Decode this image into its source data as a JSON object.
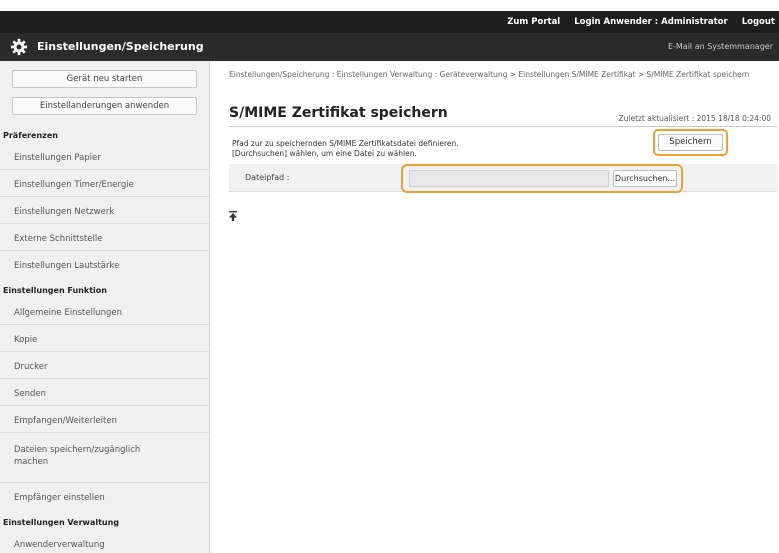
{
  "topbar": {
    "portal": "Zum Portal",
    "login_user": "Login Anwender : Administrator",
    "logout": "Logout"
  },
  "titlebar": {
    "icon": "gear-icon",
    "title": "Einstellungen/Speicherung",
    "mail": "E-Mail an Systemmanager"
  },
  "sidebar": {
    "buttons": [
      "Gerät neu starten",
      "Einstellanderungen anwenden"
    ],
    "sections": [
      {
        "label": "Präferenzen",
        "items": [
          "Einstellungen Papier",
          "Einstellungen Timer/Energie",
          "Einstellungen Netzwerk",
          "Externe Schnittstelle",
          "Einstellungen Lautstärke"
        ]
      },
      {
        "label": "Einstellungen Funktion",
        "items": [
          "Allgemeine Einstellungen",
          "Kopie",
          "Drucker",
          "Senden",
          "Empfangen/Weiterleiten",
          "Dateien speichern/zugänglich machen",
          "Empfänger einstellen"
        ]
      },
      {
        "label": "Einstellungen Verwaltung",
        "items": [
          "Anwenderverwaltung"
        ]
      }
    ]
  },
  "main": {
    "breadcrumb": "Einstellungen/Speicherung : Einstellungen Verwaltung : Geräteverwaltung > Einstellungen S/MIME Zertifikat > S/MIME Zertifikat speichern",
    "title": "S/MIME Zertifikat speichern",
    "updated": "Zuletzt aktualisiert : 2015 18/18 0:24:00",
    "desc_line1": "Pfad zur zu speichernden S/MIME Zertifikatsdatei definieren.",
    "desc_line2": "[Durchsuchen] wählen, um eine Datei zu wählen.",
    "save_label": "Speichern",
    "file_label": "Dateipfad :",
    "file_value": "",
    "browse_label": "Durchsuchen...",
    "top_icon": "scroll-top-icon"
  },
  "colors": {
    "highlight": "#f0a030",
    "titlebar": "#2b2b2b",
    "topbar": "#1e1e1e"
  }
}
